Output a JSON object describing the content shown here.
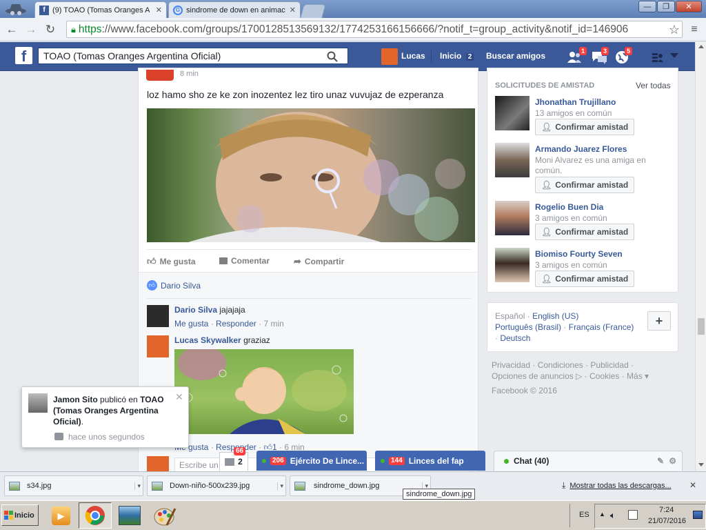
{
  "browser": {
    "tabs": [
      {
        "label": "(9) TOAO (Tomas Oranges A",
        "close": "✕"
      },
      {
        "label": "sindrome de down en animac",
        "close": "✕"
      }
    ],
    "window_controls": [
      "—",
      "❐",
      "✕"
    ],
    "url_https": "https",
    "url_rest": "://www.facebook.com/groups/1700128513569132/1774253166156666/?notif_t=group_activity&notif_id=146906"
  },
  "fb": {
    "logo": "f",
    "search_value": "TOAO (Tomas Oranges Argentina Oficial)",
    "user": "Lucas",
    "home": "Inicio",
    "home_count": "2",
    "find_friends": "Buscar amigos",
    "friend_req_count": "1",
    "msg_count": "3",
    "notif_count": "5"
  },
  "post": {
    "time": "8 min",
    "text": "loz hamo sho ze ke zon inozentez lez tiro unaz vuvujaz de ezperanza",
    "actions": {
      "like": "Me gusta",
      "comment": "Comentar",
      "share": "Compartir"
    },
    "liked_by": "Dario Silva",
    "comments": [
      {
        "author": "Dario Silva",
        "text": "jajajaja",
        "like": "Me gusta",
        "reply": "Responder",
        "time": "7 min"
      },
      {
        "author": "Lucas Skywalker",
        "text": "graziaz",
        "like": "Me gusta",
        "reply": "Responder",
        "likes": "1",
        "time": "6 min"
      }
    ],
    "write_placeholder": "Escribe un"
  },
  "friend_requests": {
    "title": "SOLICITUDES DE AMISTAD",
    "see_all": "Ver todas",
    "confirm": "Confirmar amistad",
    "items": [
      {
        "name": "Jhonathan Trujillano",
        "info": "13 amigos en común"
      },
      {
        "name": "Armando Juarez Flores",
        "info": "Moni Alvarez es una amiga en común."
      },
      {
        "name": "Rogelio Buen Dia",
        "info": "3 amigos en común"
      },
      {
        "name": "Biomiso Fourty Seven",
        "info": "3 amigos en común"
      }
    ]
  },
  "languages": {
    "line1": [
      "Español",
      "English (US)"
    ],
    "line2": [
      "Português (Brasil)",
      "Français (France)"
    ],
    "line3": [
      "Deutsch"
    ],
    "add": "+"
  },
  "footer": {
    "line1": "Privacidad · Condiciones · Publicidad ·",
    "line2": "Opciones de anuncios",
    "line2b": "· Cookies · Más ▾",
    "copyright": "Facebook © 2016"
  },
  "notification": {
    "author": "Jamon Sito",
    "mid": " publicó en ",
    "group": "TOAO (Tomas Oranges Argentina Oficial)",
    "end": ".",
    "time": "hace unos segundos"
  },
  "chatbar": {
    "conv_count": "66",
    "conv_number": "2",
    "group1_count": "206",
    "group1": "Ejército De Lince...",
    "group2_count": "144",
    "group2": "Linces del fap",
    "chat": "Chat (40)"
  },
  "downloads": {
    "items": [
      "s34.jpg",
      "Down-niño-500x239.jpg",
      "sindrome_down.jpg"
    ],
    "tooltip": "sindrome_down.jpg",
    "show_all": "Mostrar todas las descargas...",
    "close": "✕"
  },
  "taskbar": {
    "start": "Inicio",
    "lang": "ES",
    "time": "7:24",
    "date": "21/07/2016"
  }
}
